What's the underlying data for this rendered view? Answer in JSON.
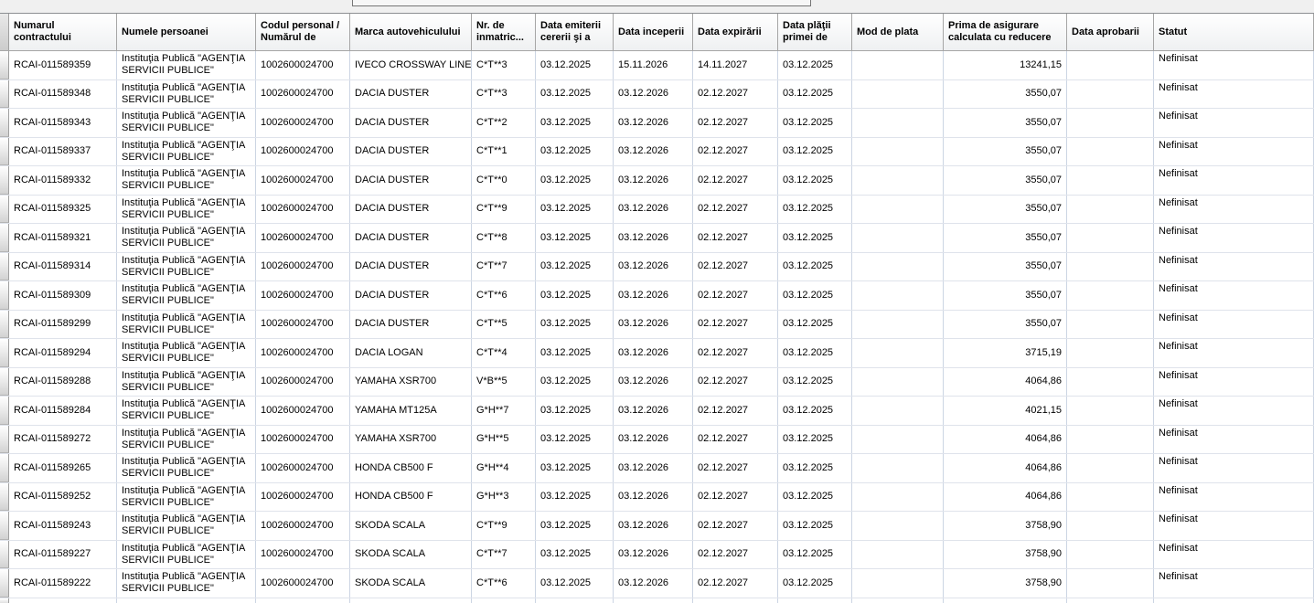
{
  "topbar": {
    "partial_control": ""
  },
  "grid": {
    "columns": [
      {
        "key": "contract",
        "label": "Numarul contractului"
      },
      {
        "key": "person",
        "label": "Numele persoanei"
      },
      {
        "key": "code",
        "label": "Codul personal / Numărul de"
      },
      {
        "key": "vehicle",
        "label": "Marca autovehiculului"
      },
      {
        "key": "plate",
        "label": "Nr. de inmatric..."
      },
      {
        "key": "date_request",
        "label": "Data emiterii cererii şi a"
      },
      {
        "key": "date_start",
        "label": "Data inceperii"
      },
      {
        "key": "date_expiry",
        "label": "Data expirării"
      },
      {
        "key": "date_payment",
        "label": "Data plăţii primei de"
      },
      {
        "key": "payment_mode",
        "label": "Mod de plata"
      },
      {
        "key": "premium",
        "label": "Prima de asigurare calculata cu reducere"
      },
      {
        "key": "date_approval",
        "label": "Data aprobarii"
      },
      {
        "key": "status",
        "label": "Statut"
      }
    ],
    "rows": [
      {
        "contract": "RCAI-011589359",
        "person": "Instituţia Publică \"AGENŢIA SERVICII PUBLICE\"",
        "code": "1002600024700",
        "vehicle": "IVECO CROSSWAY LINE...",
        "plate": "C*T**3",
        "date_request": "03.12.2025",
        "date_start": "15.11.2026",
        "date_expiry": "14.11.2027",
        "date_payment": "03.12.2025",
        "payment_mode": "",
        "premium": "13241,15",
        "date_approval": "",
        "status": "Nefinisat"
      },
      {
        "contract": "RCAI-011589348",
        "person": "Instituţia Publică \"AGENŢIA SERVICII PUBLICE\"",
        "code": "1002600024700",
        "vehicle": "DACIA DUSTER",
        "plate": "C*T**3",
        "date_request": "03.12.2025",
        "date_start": "03.12.2026",
        "date_expiry": "02.12.2027",
        "date_payment": "03.12.2025",
        "payment_mode": "",
        "premium": "3550,07",
        "date_approval": "",
        "status": "Nefinisat"
      },
      {
        "contract": "RCAI-011589343",
        "person": "Instituţia Publică \"AGENŢIA SERVICII PUBLICE\"",
        "code": "1002600024700",
        "vehicle": "DACIA DUSTER",
        "plate": "C*T**2",
        "date_request": "03.12.2025",
        "date_start": "03.12.2026",
        "date_expiry": "02.12.2027",
        "date_payment": "03.12.2025",
        "payment_mode": "",
        "premium": "3550,07",
        "date_approval": "",
        "status": "Nefinisat"
      },
      {
        "contract": "RCAI-011589337",
        "person": "Instituţia Publică \"AGENŢIA SERVICII PUBLICE\"",
        "code": "1002600024700",
        "vehicle": "DACIA DUSTER",
        "plate": "C*T**1",
        "date_request": "03.12.2025",
        "date_start": "03.12.2026",
        "date_expiry": "02.12.2027",
        "date_payment": "03.12.2025",
        "payment_mode": "",
        "premium": "3550,07",
        "date_approval": "",
        "status": "Nefinisat"
      },
      {
        "contract": "RCAI-011589332",
        "person": "Instituţia Publică \"AGENŢIA SERVICII PUBLICE\"",
        "code": "1002600024700",
        "vehicle": "DACIA DUSTER",
        "plate": "C*T**0",
        "date_request": "03.12.2025",
        "date_start": "03.12.2026",
        "date_expiry": "02.12.2027",
        "date_payment": "03.12.2025",
        "payment_mode": "",
        "premium": "3550,07",
        "date_approval": "",
        "status": "Nefinisat"
      },
      {
        "contract": "RCAI-011589325",
        "person": "Instituţia Publică \"AGENŢIA SERVICII PUBLICE\"",
        "code": "1002600024700",
        "vehicle": "DACIA DUSTER",
        "plate": "C*T**9",
        "date_request": "03.12.2025",
        "date_start": "03.12.2026",
        "date_expiry": "02.12.2027",
        "date_payment": "03.12.2025",
        "payment_mode": "",
        "premium": "3550,07",
        "date_approval": "",
        "status": "Nefinisat"
      },
      {
        "contract": "RCAI-011589321",
        "person": "Instituţia Publică \"AGENŢIA SERVICII PUBLICE\"",
        "code": "1002600024700",
        "vehicle": "DACIA DUSTER",
        "plate": "C*T**8",
        "date_request": "03.12.2025",
        "date_start": "03.12.2026",
        "date_expiry": "02.12.2027",
        "date_payment": "03.12.2025",
        "payment_mode": "",
        "premium": "3550,07",
        "date_approval": "",
        "status": "Nefinisat"
      },
      {
        "contract": "RCAI-011589314",
        "person": "Instituţia Publică \"AGENŢIA SERVICII PUBLICE\"",
        "code": "1002600024700",
        "vehicle": "DACIA DUSTER",
        "plate": "C*T**7",
        "date_request": "03.12.2025",
        "date_start": "03.12.2026",
        "date_expiry": "02.12.2027",
        "date_payment": "03.12.2025",
        "payment_mode": "",
        "premium": "3550,07",
        "date_approval": "",
        "status": "Nefinisat"
      },
      {
        "contract": "RCAI-011589309",
        "person": "Instituţia Publică \"AGENŢIA SERVICII PUBLICE\"",
        "code": "1002600024700",
        "vehicle": "DACIA DUSTER",
        "plate": "C*T**6",
        "date_request": "03.12.2025",
        "date_start": "03.12.2026",
        "date_expiry": "02.12.2027",
        "date_payment": "03.12.2025",
        "payment_mode": "",
        "premium": "3550,07",
        "date_approval": "",
        "status": "Nefinisat"
      },
      {
        "contract": "RCAI-011589299",
        "person": "Instituţia Publică \"AGENŢIA SERVICII PUBLICE\"",
        "code": "1002600024700",
        "vehicle": "DACIA DUSTER",
        "plate": "C*T**5",
        "date_request": "03.12.2025",
        "date_start": "03.12.2026",
        "date_expiry": "02.12.2027",
        "date_payment": "03.12.2025",
        "payment_mode": "",
        "premium": "3550,07",
        "date_approval": "",
        "status": "Nefinisat"
      },
      {
        "contract": "RCAI-011589294",
        "person": "Instituţia Publică \"AGENŢIA SERVICII PUBLICE\"",
        "code": "1002600024700",
        "vehicle": "DACIA LOGAN",
        "plate": "C*T**4",
        "date_request": "03.12.2025",
        "date_start": "03.12.2026",
        "date_expiry": "02.12.2027",
        "date_payment": "03.12.2025",
        "payment_mode": "",
        "premium": "3715,19",
        "date_approval": "",
        "status": "Nefinisat"
      },
      {
        "contract": "RCAI-011589288",
        "person": "Instituţia Publică \"AGENŢIA SERVICII PUBLICE\"",
        "code": "1002600024700",
        "vehicle": "YAMAHA XSR700",
        "plate": "V*B**5",
        "date_request": "03.12.2025",
        "date_start": "03.12.2026",
        "date_expiry": "02.12.2027",
        "date_payment": "03.12.2025",
        "payment_mode": "",
        "premium": "4064,86",
        "date_approval": "",
        "status": "Nefinisat"
      },
      {
        "contract": "RCAI-011589284",
        "person": "Instituţia Publică \"AGENŢIA SERVICII PUBLICE\"",
        "code": "1002600024700",
        "vehicle": "YAMAHA MT125A",
        "plate": "G*H**7",
        "date_request": "03.12.2025",
        "date_start": "03.12.2026",
        "date_expiry": "02.12.2027",
        "date_payment": "03.12.2025",
        "payment_mode": "",
        "premium": "4021,15",
        "date_approval": "",
        "status": "Nefinisat"
      },
      {
        "contract": "RCAI-011589272",
        "person": "Instituţia Publică \"AGENŢIA SERVICII PUBLICE\"",
        "code": "1002600024700",
        "vehicle": "YAMAHA XSR700",
        "plate": "G*H**5",
        "date_request": "03.12.2025",
        "date_start": "03.12.2026",
        "date_expiry": "02.12.2027",
        "date_payment": "03.12.2025",
        "payment_mode": "",
        "premium": "4064,86",
        "date_approval": "",
        "status": "Nefinisat"
      },
      {
        "contract": "RCAI-011589265",
        "person": "Instituţia Publică \"AGENŢIA SERVICII PUBLICE\"",
        "code": "1002600024700",
        "vehicle": "HONDA CB500 F",
        "plate": "G*H**4",
        "date_request": "03.12.2025",
        "date_start": "03.12.2026",
        "date_expiry": "02.12.2027",
        "date_payment": "03.12.2025",
        "payment_mode": "",
        "premium": "4064,86",
        "date_approval": "",
        "status": "Nefinisat"
      },
      {
        "contract": "RCAI-011589252",
        "person": "Instituţia Publică \"AGENŢIA SERVICII PUBLICE\"",
        "code": "1002600024700",
        "vehicle": "HONDA CB500 F",
        "plate": "G*H**3",
        "date_request": "03.12.2025",
        "date_start": "03.12.2026",
        "date_expiry": "02.12.2027",
        "date_payment": "03.12.2025",
        "payment_mode": "",
        "premium": "4064,86",
        "date_approval": "",
        "status": "Nefinisat"
      },
      {
        "contract": "RCAI-011589243",
        "person": "Instituţia Publică \"AGENŢIA SERVICII PUBLICE\"",
        "code": "1002600024700",
        "vehicle": "SKODA SCALA",
        "plate": "C*T**9",
        "date_request": "03.12.2025",
        "date_start": "03.12.2026",
        "date_expiry": "02.12.2027",
        "date_payment": "03.12.2025",
        "payment_mode": "",
        "premium": "3758,90",
        "date_approval": "",
        "status": "Nefinisat"
      },
      {
        "contract": "RCAI-011589227",
        "person": "Instituţia Publică \"AGENŢIA SERVICII PUBLICE\"",
        "code": "1002600024700",
        "vehicle": "SKODA SCALA",
        "plate": "C*T**7",
        "date_request": "03.12.2025",
        "date_start": "03.12.2026",
        "date_expiry": "02.12.2027",
        "date_payment": "03.12.2025",
        "payment_mode": "",
        "premium": "3758,90",
        "date_approval": "",
        "status": "Nefinisat"
      },
      {
        "contract": "RCAI-011589222",
        "person": "Instituţia Publică \"AGENŢIA SERVICII PUBLICE\"",
        "code": "1002600024700",
        "vehicle": "SKODA SCALA",
        "plate": "C*T**6",
        "date_request": "03.12.2025",
        "date_start": "03.12.2026",
        "date_expiry": "02.12.2027",
        "date_payment": "03.12.2025",
        "payment_mode": "",
        "premium": "3758,90",
        "date_approval": "",
        "status": "Nefinisat"
      }
    ]
  }
}
